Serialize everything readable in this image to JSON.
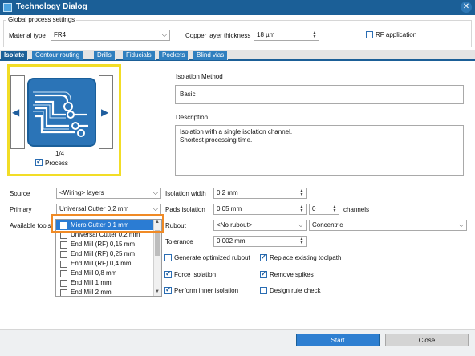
{
  "window": {
    "title": "Technology Dialog",
    "close_glyph": "✕",
    "app_icon": "app-icon"
  },
  "global": {
    "group_title": "Global process settings",
    "material_label": "Material type",
    "material_value": "FR4",
    "copper_label": "Copper layer thickness",
    "copper_value": "18 µm",
    "rf_label": "RF application",
    "rf_checked": false
  },
  "tabs": [
    "Isolate",
    "Contour routing",
    "Drills",
    "Fiducials",
    "Pockets",
    "Blind vias"
  ],
  "active_tab": "Isolate",
  "preview": {
    "page": "1/4",
    "process_label": "Process",
    "process_checked": true,
    "left_arrow": "◀",
    "right_arrow": "▶"
  },
  "isolation": {
    "method_label": "Isolation Method",
    "method_value": "Basic",
    "description_label": "Description",
    "description_line1": "Isolation with a single isolation channel.",
    "description_line2": "Shortest processing time."
  },
  "left_form": {
    "source_label": "Source",
    "source_value": "<Wiring> layers",
    "primary_label": "Primary",
    "primary_value": "Universal Cutter 0,2 mm",
    "tools_label": "Available tools"
  },
  "tools": [
    {
      "label": "Micro Cutter 0,1 mm",
      "selected": true
    },
    {
      "label": "Universal Cutter 0,2 mm",
      "selected": false
    },
    {
      "label": "End Mill (RF) 0,15 mm",
      "selected": false
    },
    {
      "label": "End Mill (RF) 0,25 mm",
      "selected": false
    },
    {
      "label": "End Mill (RF) 0,4 mm",
      "selected": false
    },
    {
      "label": "End Mill 0,8 mm",
      "selected": false
    },
    {
      "label": "End Mill 1 mm",
      "selected": false
    },
    {
      "label": "End Mill 2 mm",
      "selected": false
    }
  ],
  "right_form": {
    "width_label": "Isolation width",
    "width_value": "0.2 mm",
    "pads_label": "Pads isolation",
    "pads_value": "0.05 mm",
    "channels_value": "0",
    "channels_label": "channels",
    "rubout_label": "Rubout",
    "rubout_value": "<No rubout>",
    "rubout_mode": "Concentric",
    "tolerance_label": "Tolerance",
    "tolerance_value": "0.002 mm"
  },
  "options": [
    {
      "label": "Generate optimized rubout",
      "checked": false
    },
    {
      "label": "Replace existing toolpath",
      "checked": true
    },
    {
      "label": "Force isolation",
      "checked": true
    },
    {
      "label": "Remove spikes",
      "checked": true
    },
    {
      "label": "Perform inner isolation",
      "checked": true
    },
    {
      "label": "Design rule check",
      "checked": false
    }
  ],
  "buttons": {
    "start": "Start",
    "close": "Close"
  },
  "colors": {
    "title_bar": "#1b5f97",
    "tab_active": "#1b5f97",
    "highlight_yellow": "#f2dd26",
    "highlight_orange": "#f08a25",
    "start_button": "#2e7fd1",
    "selection": "#2b7cd3"
  }
}
